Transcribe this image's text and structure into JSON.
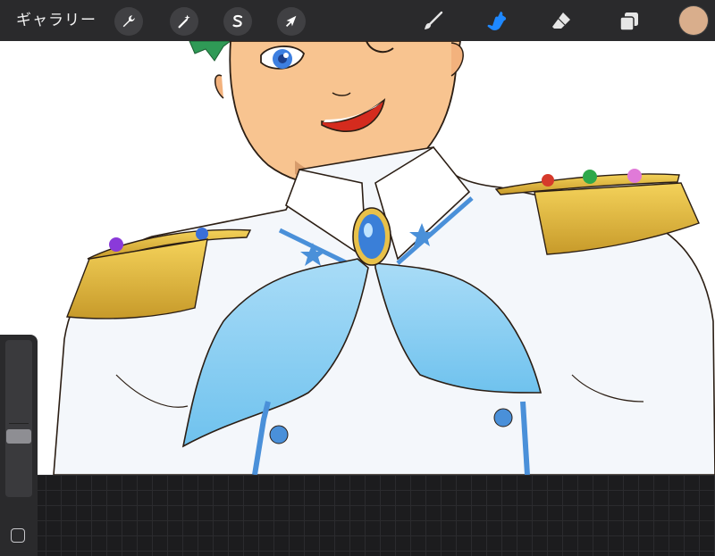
{
  "toolbar": {
    "gallery_label": "ギャラリー",
    "actions_icon": "wrench-icon",
    "adjustments_icon": "magic-wand-icon",
    "selection_icon": "selection-s-icon",
    "transform_icon": "arrow-cursor-icon",
    "brush_icon": "paintbrush-icon",
    "smudge_icon": "smudge-finger-icon",
    "eraser_icon": "eraser-icon",
    "layers_icon": "layers-icon",
    "current_color": "#d9ae8c",
    "active_tool_color": "#1e88ff"
  },
  "sidebar": {
    "brush_size_icon": "slider-icon",
    "modify_icon": "square-icon"
  },
  "canvas": {
    "artwork": "anime-character-illustration"
  }
}
